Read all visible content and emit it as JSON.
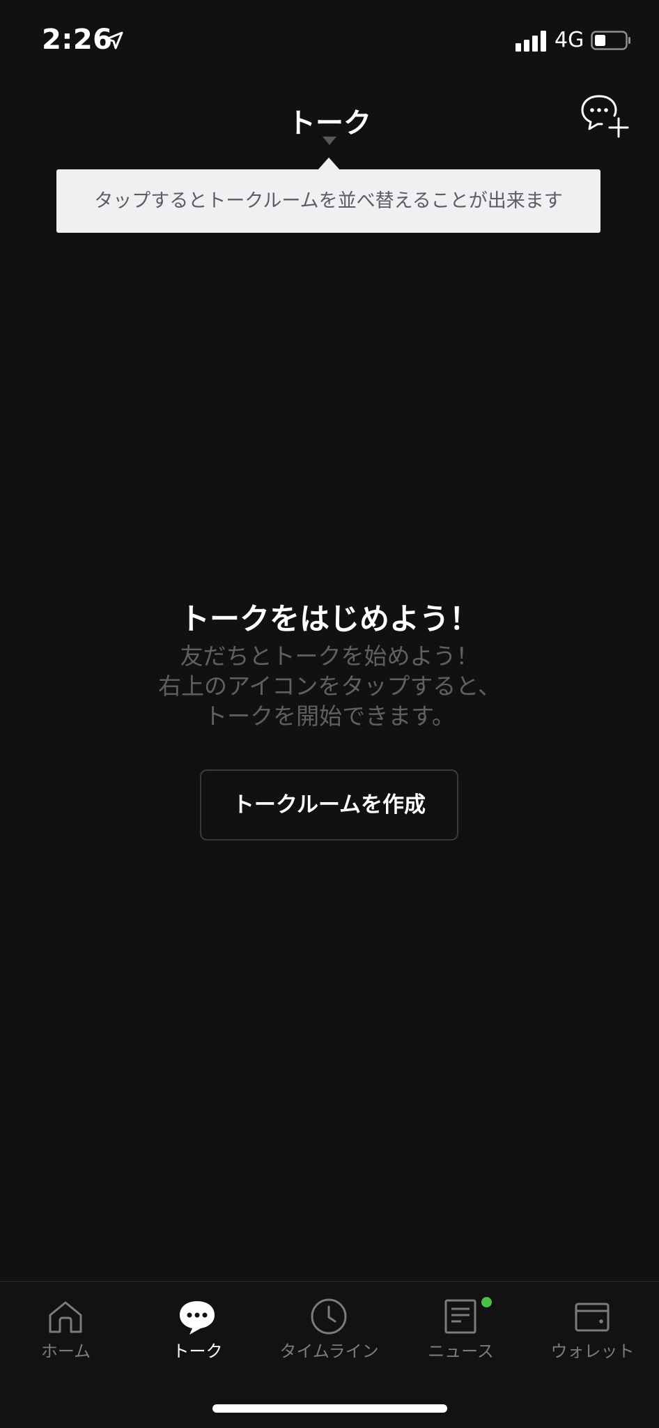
{
  "status": {
    "time": "2:26",
    "network": "4G"
  },
  "header": {
    "title": "トーク"
  },
  "tooltip": {
    "text": "タップするとトークルームを並べ替えることが出来ます"
  },
  "empty_state": {
    "title": "トークをはじめよう！",
    "description_lines": [
      "友だちとトークを始めよう！",
      "右上のアイコンをタップすると、",
      "トークを開始できます。"
    ],
    "button_label": "トークルームを作成"
  },
  "tabs": [
    {
      "label": "ホーム",
      "icon": "home-icon",
      "active": false
    },
    {
      "label": "トーク",
      "icon": "chat-bubble-icon",
      "active": true
    },
    {
      "label": "タイムライン",
      "icon": "clock-icon",
      "active": false
    },
    {
      "label": "ニュース",
      "icon": "news-icon",
      "active": false,
      "badge": true
    },
    {
      "label": "ウォレット",
      "icon": "wallet-icon",
      "active": false
    }
  ],
  "colors": {
    "background": "#111111",
    "tooltip_bg": "#eff0f2",
    "badge": "#4cbe47",
    "inactive": "#7b7c80"
  }
}
